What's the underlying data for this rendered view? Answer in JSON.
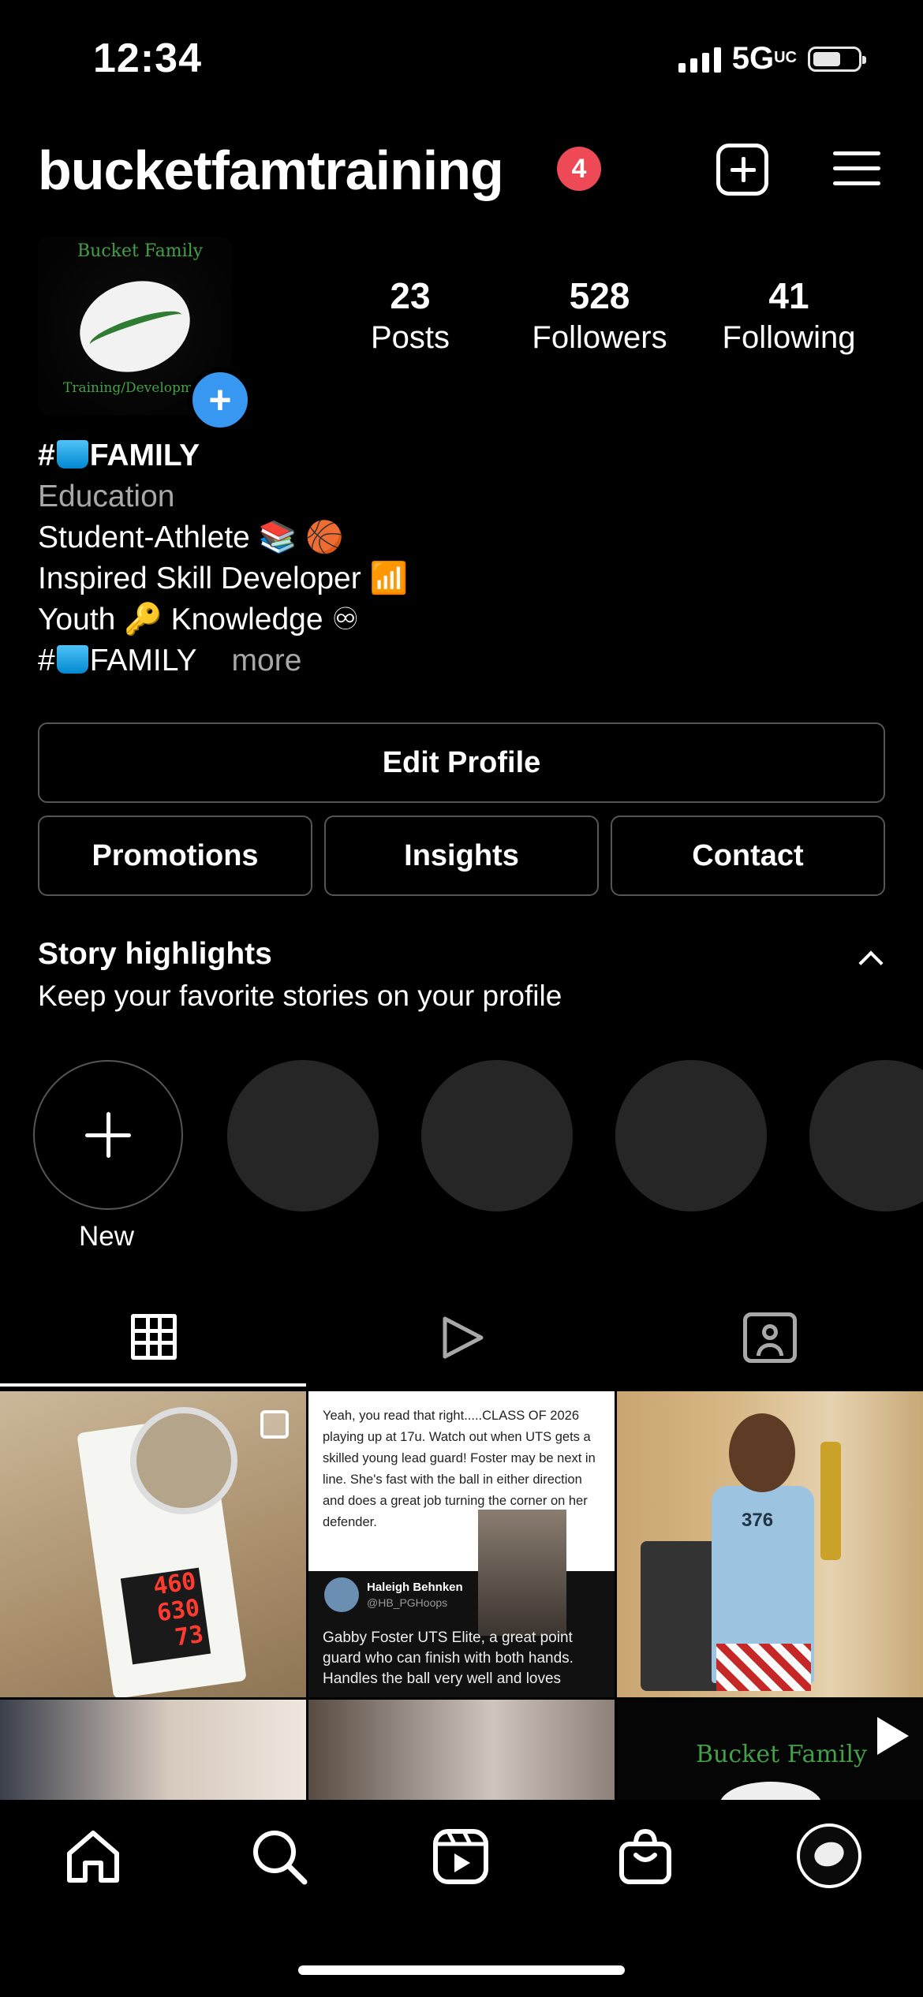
{
  "status_bar": {
    "time": "12:34",
    "network": "5G",
    "network_suffix": "UC"
  },
  "header": {
    "username": "bucketfamtraining",
    "notification_count": "4"
  },
  "profile": {
    "avatar_text_top": "Bucket Family",
    "avatar_text_bottom": "Training/Developm",
    "stats": [
      {
        "value": "23",
        "label": "Posts"
      },
      {
        "value": "528",
        "label": "Followers"
      },
      {
        "value": "41",
        "label": "Following"
      }
    ]
  },
  "bio": {
    "name_prefix": "#",
    "name": "FAMILY",
    "category": "Education",
    "line1": "Student-Athlete 📚 🏀",
    "line2": "Inspired Skill Developer 📶",
    "line3": "Youth 🔑 Knowledge ♾",
    "line4_prefix": "#",
    "line4": "FAMILY",
    "more": "more"
  },
  "buttons": {
    "edit_profile": "Edit Profile",
    "promotions": "Promotions",
    "insights": "Insights",
    "contact": "Contact"
  },
  "highlights": {
    "title": "Story highlights",
    "subtitle": "Keep your favorite stories on your profile",
    "new_label": "New"
  },
  "posts": {
    "p1_scores": [
      "460",
      "630",
      "73"
    ],
    "p2_tweet": "Yeah, you read that right.....CLASS OF 2026 playing up at 17u. Watch out when UTS gets a skilled young lead guard! Foster may be next in line. She's fast with the ball in either direction and does a great job turning the corner on her defender.",
    "p2_author": "Haleigh Behnken",
    "p2_handle": "@HB_PGHoops",
    "p2_caption": "Gabby Foster UTS Elite, a great point guard who can finish with both hands. Handles the ball very well and loves",
    "p3_jersey": "376",
    "p6_text": "Bucket Family"
  },
  "colors": {
    "notification": "#ed4956",
    "accent_blue": "#3897f0",
    "logo_green": "#43a047"
  },
  "icons": [
    "add-post-icon",
    "menu-icon",
    "grid-icon",
    "reels-tab-icon",
    "tagged-icon",
    "home-icon",
    "search-icon",
    "reels-icon",
    "shop-icon"
  ]
}
